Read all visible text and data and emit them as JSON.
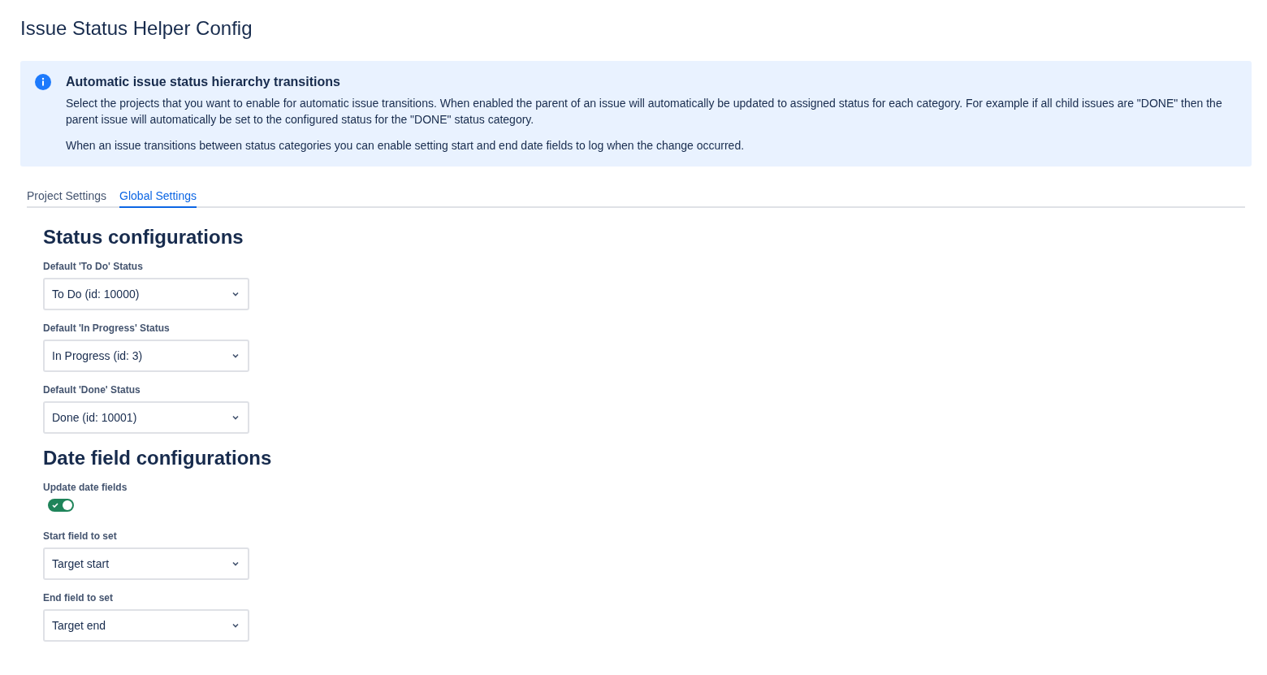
{
  "page_title": "Issue Status Helper Config",
  "banner": {
    "title": "Automatic issue status hierarchy transitions",
    "paragraphs": [
      "Select the projects that you want to enable for automatic issue transitions. When enabled the parent of an issue will automatically be updated to assigned status for each category. For example if all child issues are \"DONE\" then the parent issue will automatically be set to the configured status for the \"DONE\" status category.",
      "When an issue transitions between status categories you can enable setting start and end date fields to log when the change occurred."
    ]
  },
  "tabs": [
    {
      "label": "Project Settings",
      "selected": false
    },
    {
      "label": "Global Settings",
      "selected": true
    }
  ],
  "sections": [
    {
      "heading": "Status configurations",
      "fields": [
        {
          "kind": "select",
          "label": "Default 'To Do' Status",
          "value": "To Do (id: 10000)"
        },
        {
          "kind": "select",
          "label": "Default 'In Progress' Status",
          "value": "In Progress (id: 3)"
        },
        {
          "kind": "select",
          "label": "Default 'Done' Status",
          "value": "Done (id: 10001)"
        }
      ]
    },
    {
      "heading": "Date field configurations",
      "fields": [
        {
          "kind": "toggle",
          "label": "Update date fields",
          "on": true
        },
        {
          "kind": "select",
          "label": "Start field to set",
          "value": "Target start"
        },
        {
          "kind": "select",
          "label": "End field to set",
          "value": "Target end"
        }
      ]
    }
  ]
}
